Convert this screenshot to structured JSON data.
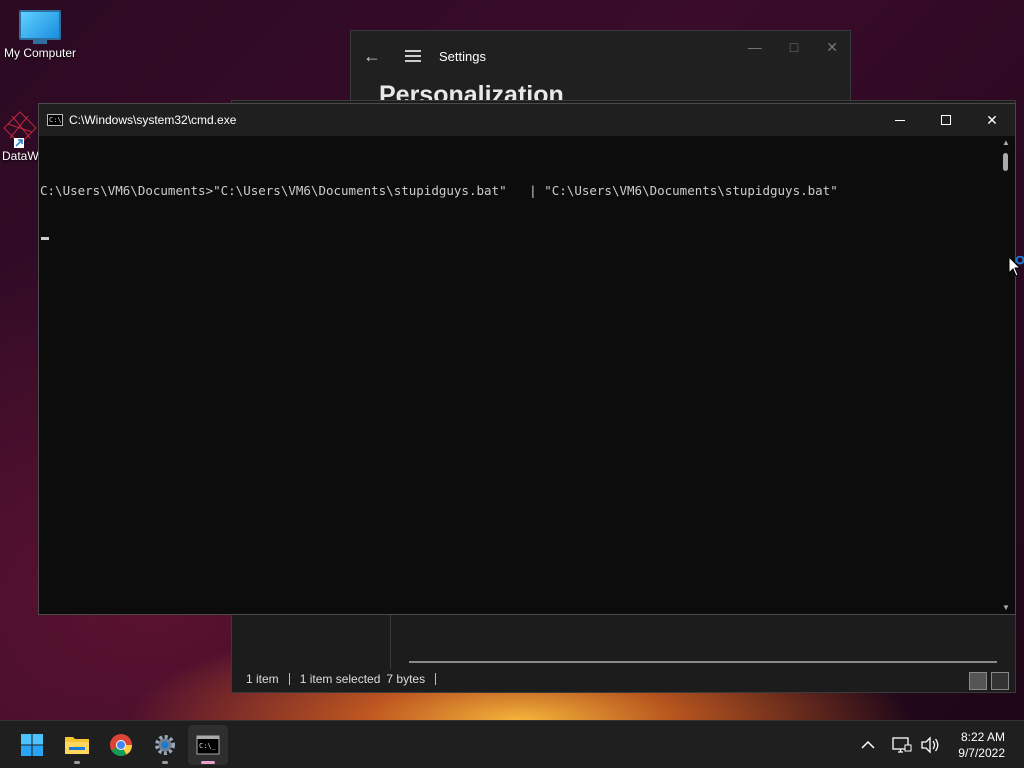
{
  "desktop": {
    "icons": [
      {
        "label": "My Computer",
        "icon": "monitor-icon"
      },
      {
        "label": "DataW",
        "icon": "datawrapper-shortcut-icon"
      }
    ]
  },
  "settings_window": {
    "title": "Settings",
    "heading": "Personalization"
  },
  "explorer_window": {
    "status": {
      "item_count": "1 item",
      "selection": "1 item selected",
      "size": "7 bytes"
    }
  },
  "cmd_window": {
    "title": "C:\\Windows\\system32\\cmd.exe",
    "lines": [
      "C:\\Users\\VM6\\Documents>\"C:\\Users\\VM6\\Documents\\stupidguys.bat\"   | \"C:\\Users\\VM6\\Documents\\stupidguys.bat\""
    ]
  },
  "taskbar": {
    "apps": [
      {
        "name": "start",
        "icon": "windows-logo-icon"
      },
      {
        "name": "file-explorer",
        "icon": "folder-icon"
      },
      {
        "name": "chrome",
        "icon": "chrome-icon"
      },
      {
        "name": "settings",
        "icon": "gear-icon"
      },
      {
        "name": "cmd",
        "icon": "terminal-icon",
        "active": true
      }
    ],
    "clock": {
      "time": "8:22 AM",
      "date": "9/7/2022"
    }
  }
}
